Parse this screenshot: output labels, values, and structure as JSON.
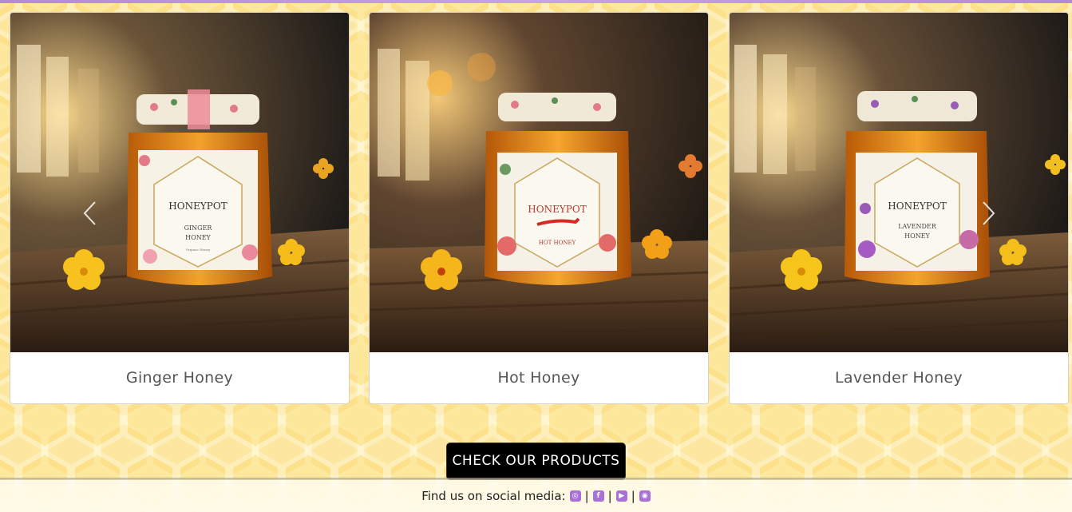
{
  "products": [
    {
      "name": "Ginger Honey",
      "label_line1": "GINGER",
      "label_line2": "HONEY",
      "label_small": "Organic Honey"
    },
    {
      "name": "Hot Honey",
      "label_line1": "HOT HONEY",
      "label_line2": "",
      "label_small": ""
    },
    {
      "name": "Lavender Honey",
      "label_line1": "LAVENDER",
      "label_line2": "HONEY",
      "label_small": ""
    }
  ],
  "brand": "HONEYPOT",
  "carousel": {
    "prev_icon": "chevron-left-icon",
    "next_icon": "chevron-right-icon"
  },
  "cta": {
    "label": "CHECK OUR PRODUCTS"
  },
  "footer": {
    "text": "Find us on social media:",
    "separator": "|",
    "socials": [
      {
        "icon": "github-icon",
        "glyph": "◎"
      },
      {
        "icon": "facebook-icon",
        "glyph": "f"
      },
      {
        "icon": "youtube-icon",
        "glyph": "▶"
      },
      {
        "icon": "instagram-icon",
        "glyph": "◉"
      }
    ]
  },
  "colors": {
    "accent": "#a970d6",
    "cta_bg": "#000000",
    "honey": "#e08a12",
    "background": "#fff6cf"
  }
}
